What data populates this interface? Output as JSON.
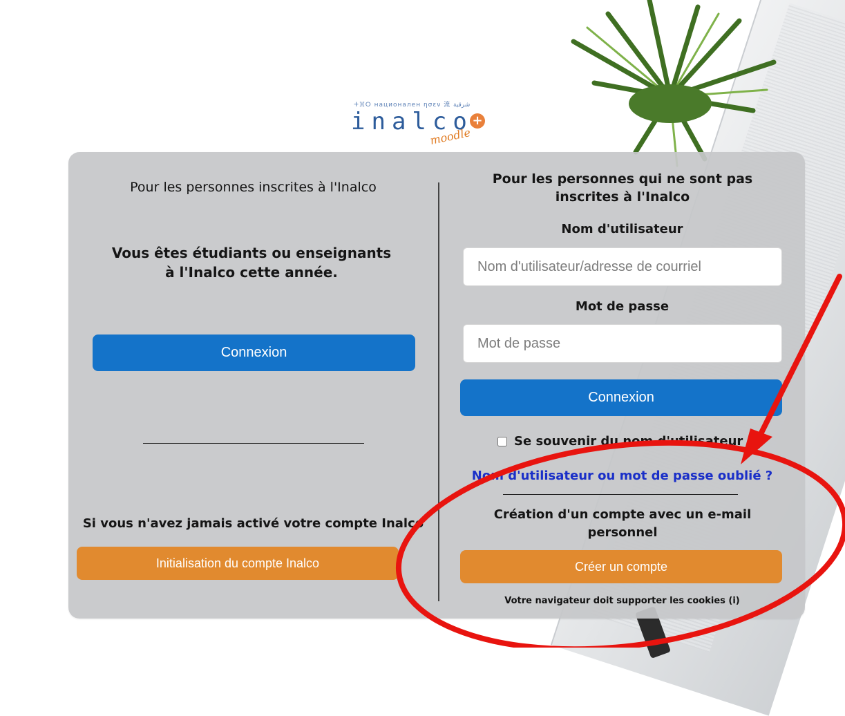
{
  "logo": {
    "scripts": "ⵜⴼⵔ национален ησεν 流 شرقية",
    "word": "inalco",
    "moodle": "moodle",
    "plus": "+"
  },
  "left": {
    "heading": "Pour les personnes inscrites à l'Inalco",
    "subheading": "Vous êtes étudiants ou enseignants à l'Inalco cette année.",
    "login_button": "Connexion",
    "activate_text": "Si vous n'avez jamais activé votre compte Inalco",
    "init_button": "Initialisation du compte Inalco"
  },
  "right": {
    "heading": "Pour les personnes qui ne sont pas inscrites à l'Inalco",
    "username_label": "Nom d'utilisateur",
    "username_placeholder": "Nom d'utilisateur/adresse de courriel",
    "password_label": "Mot de passe",
    "password_placeholder": "Mot de passe",
    "login_button": "Connexion",
    "remember_label": "Se souvenir du nom d'utilisateur",
    "forgot_link": "Nom d'utilisateur ou mot de passe oublié ?",
    "create_heading": "Création d'un compte avec un e-mail personnel",
    "create_button": "Créer un compte",
    "cookies_note": "Votre navigateur doit supporter les cookies (i)"
  },
  "colors": {
    "primary_blue": "#1473c9",
    "accent_orange": "#e18a2f",
    "link_blue": "#1a2fc8",
    "annotation_red": "#e8140f"
  }
}
